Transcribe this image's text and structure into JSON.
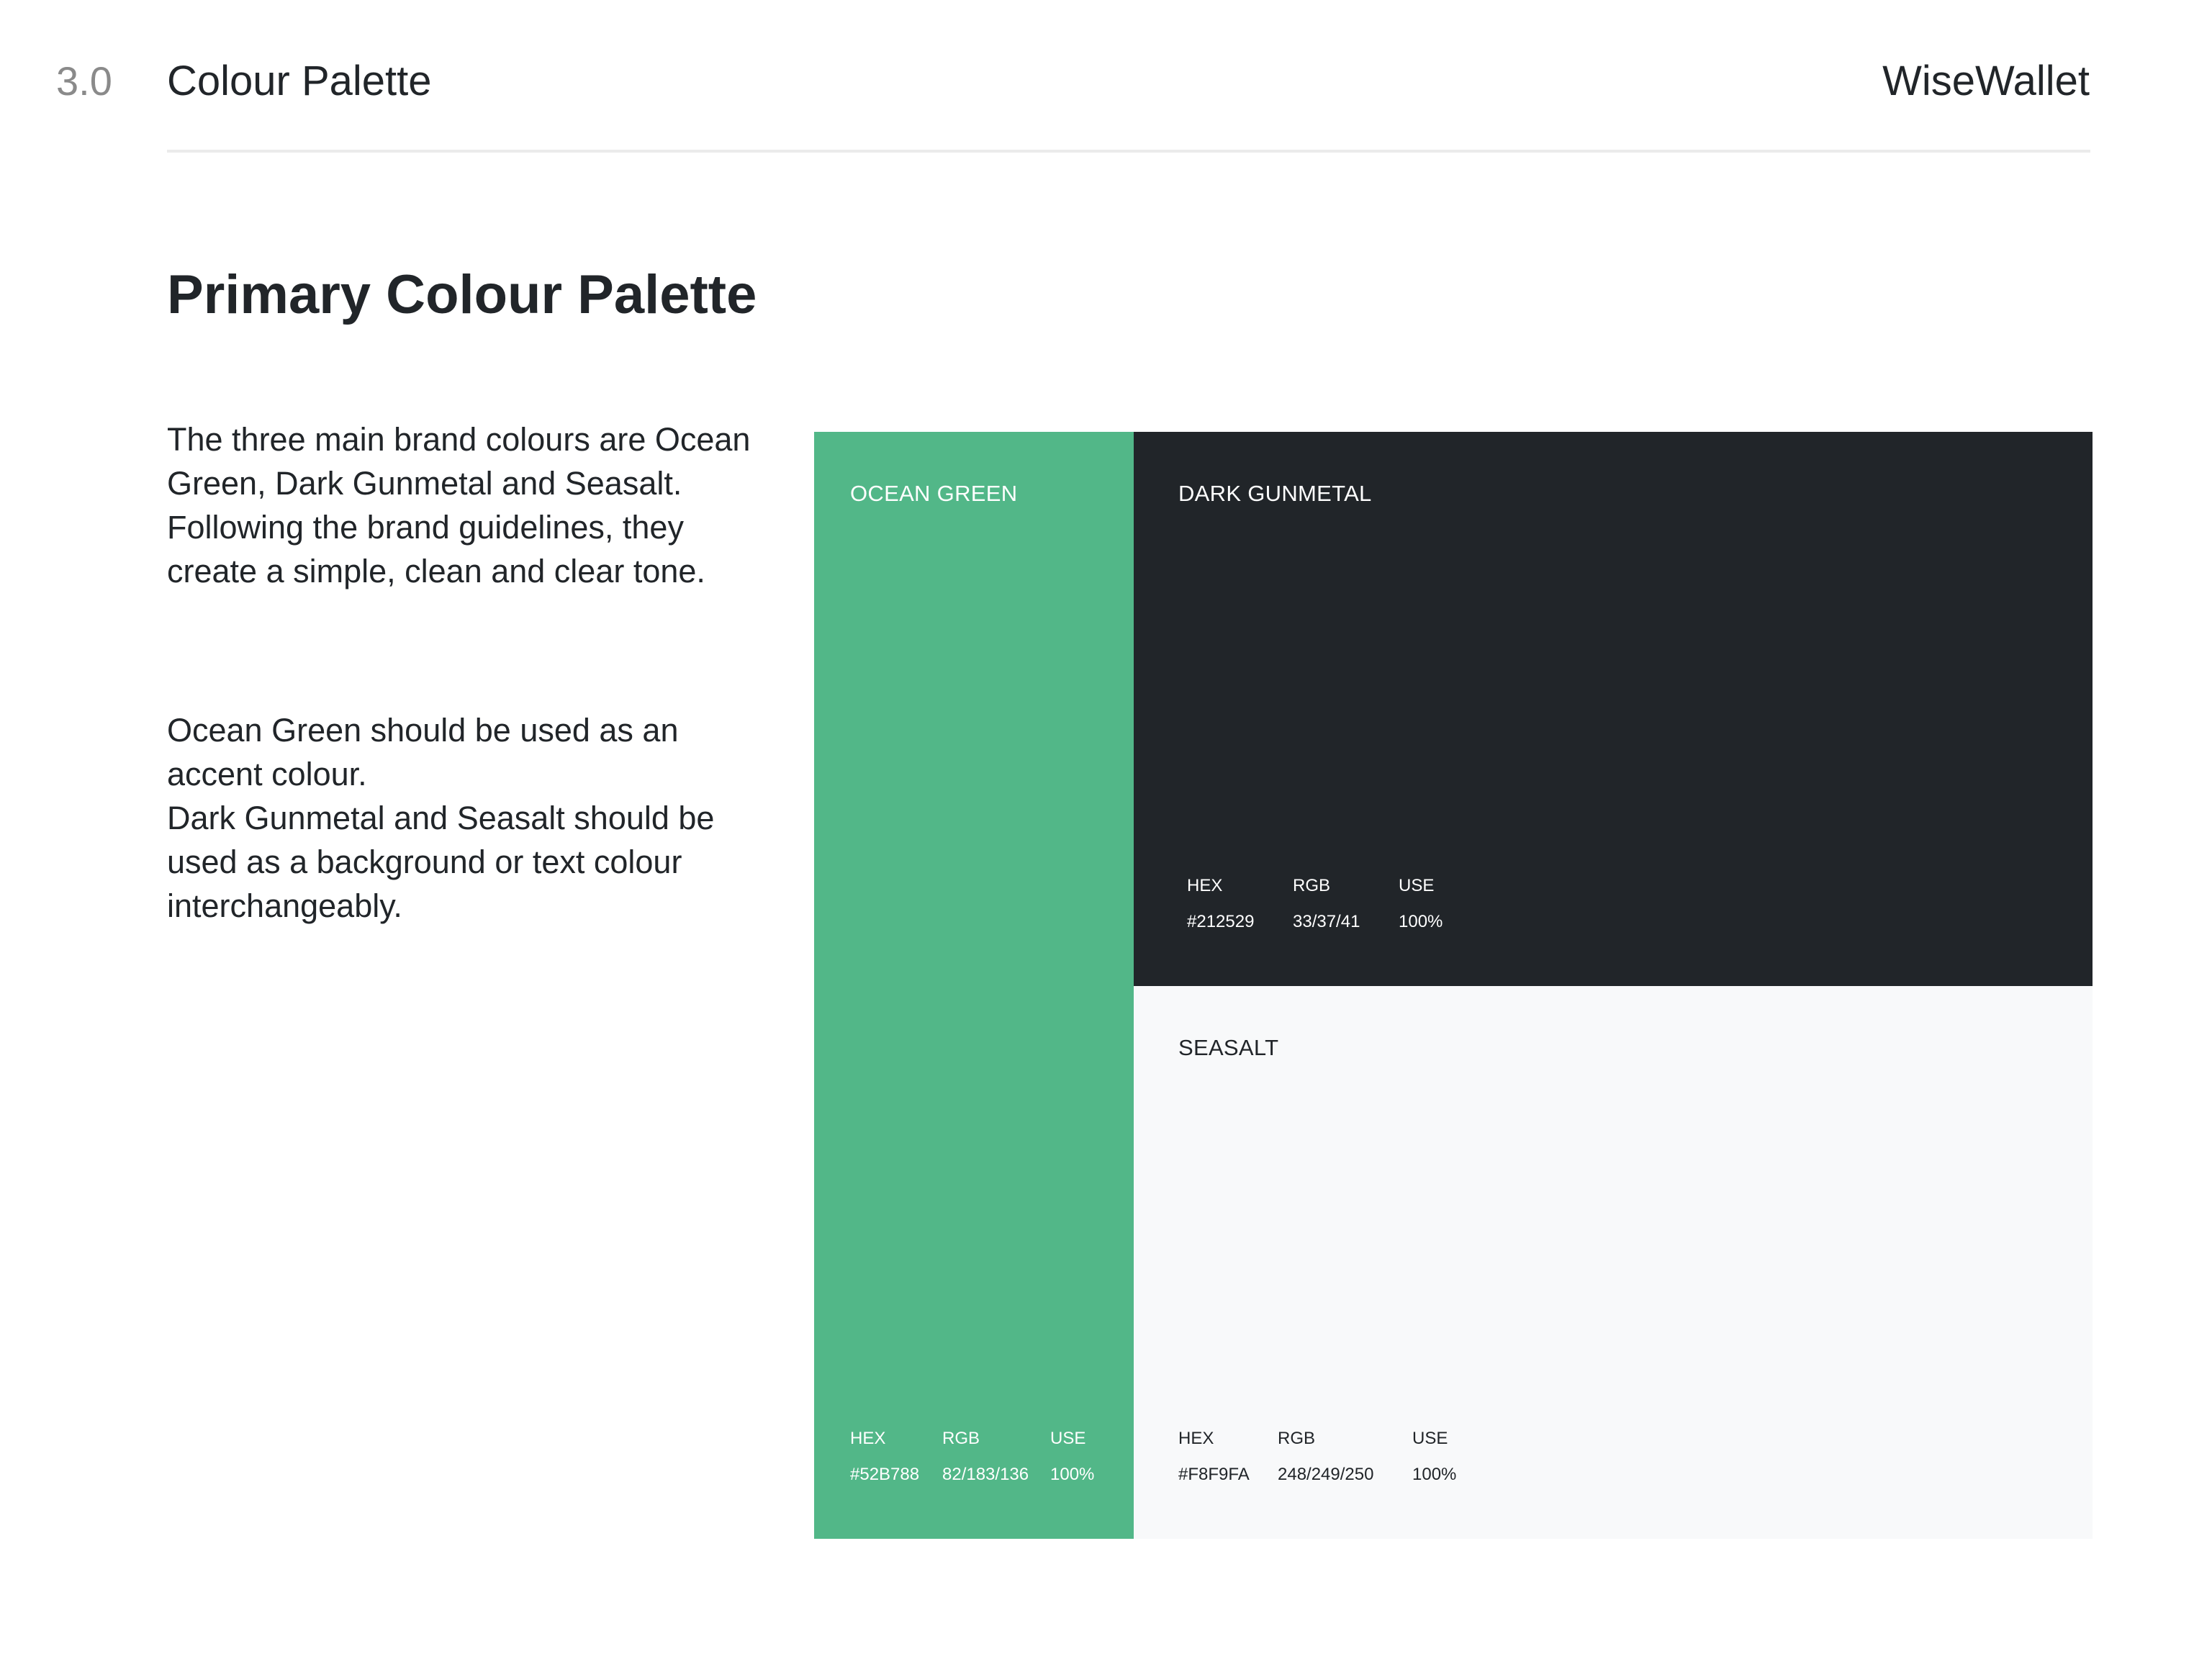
{
  "header": {
    "section_number": "3.0",
    "section_title": "Colour Palette",
    "brand": "WiseWallet"
  },
  "main": {
    "heading": "Primary Colour Palette",
    "paragraphs": [
      "The three main brand colours are Ocean Green, Dark Gunmetal and Seasalt. Following the brand guidelines, they create a simple, clean and clear tone.",
      "Ocean Green should be used as an accent colour.\nDark Gunmetal and Seasalt should be used as a background or text colour interchangeably."
    ]
  },
  "spec_labels": {
    "hex": "HEX",
    "rgb": "RGB",
    "use": "USE"
  },
  "swatches": [
    {
      "name": "OCEAN GREEN",
      "color": "#52B788",
      "text_color": "#ffffff",
      "hex": "#52B788",
      "rgb": "82/183/136",
      "use": "100%"
    },
    {
      "name": "DARK GUNMETAL",
      "color": "#212529",
      "text_color": "#ffffff",
      "hex": "#212529",
      "rgb": "33/37/41",
      "use": "100%"
    },
    {
      "name": "SEASALT",
      "color": "#F8F9FA",
      "text_color": "#212529",
      "hex": "#F8F9FA",
      "rgb": "248/249/250",
      "use": "100%"
    }
  ]
}
